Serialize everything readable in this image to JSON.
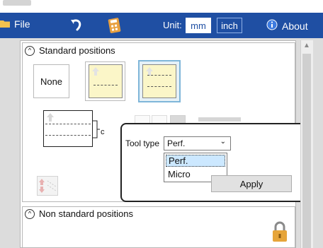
{
  "toolbar": {
    "file_label": "File",
    "unit_label": "Unit:",
    "unit_mm": "mm",
    "unit_inch": "inch",
    "about_label": "About",
    "colors": {
      "bar": "#1f4fa3",
      "active_unit_bg": "#ffffff"
    },
    "icons": [
      "folder-icon",
      "undo-icon",
      "calculator-icon",
      "info-icon"
    ]
  },
  "standard": {
    "title": "Standard positions",
    "none_label": "None",
    "dim_label": "c"
  },
  "popup": {
    "tool_type_label": "Tool type",
    "selected_value": "Perf.",
    "options": [
      "Perf.",
      "Micro"
    ],
    "apply_label": "Apply"
  },
  "nonstandard": {
    "title": "Non standard positions"
  }
}
